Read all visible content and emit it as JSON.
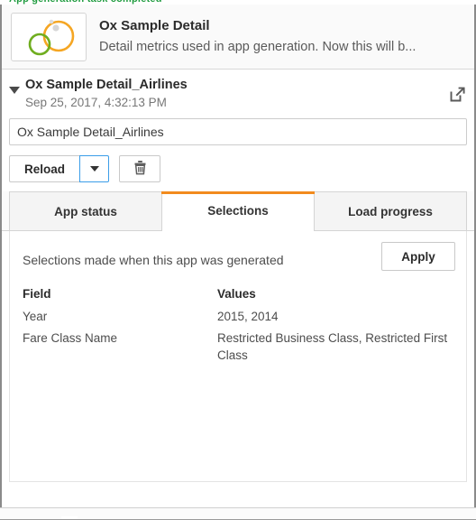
{
  "window": {
    "clipped_top_text": "App generation task completed"
  },
  "app_header": {
    "icon": "qlik-app-thumbnail-icon",
    "title": "Ox Sample Detail",
    "description": "Detail metrics used in app generation. Now this will b...",
    "logo_colors": {
      "orange": "#F5A623",
      "green": "#6FAD1F",
      "dot": "#D8D8D8"
    }
  },
  "task_header": {
    "caret_icon": "chevron-down-icon",
    "name": "Ox Sample Detail_Airlines",
    "timestamp": "Sep 25, 2017, 4:32:13 PM",
    "open_external_icon": "open-in-new-window-icon"
  },
  "name_field": {
    "value": "Ox Sample Detail_Airlines",
    "placeholder": "Ox Sample Detail_Airlines"
  },
  "actions": {
    "reload_label": "Reload",
    "reload_dropdown_icon": "caret-down-icon",
    "reload_dropdown_focus_color": "#3B9DE8",
    "delete_icon": "trash-icon"
  },
  "tabs": {
    "active_index": 1,
    "active_underline_color": "#F28B1E",
    "items": [
      {
        "label": "App status"
      },
      {
        "label": "Selections"
      },
      {
        "label": "Load progress"
      }
    ]
  },
  "selections_panel": {
    "caption": "Selections made when this app was generated",
    "apply_label": "Apply",
    "columns": [
      "Field",
      "Values"
    ],
    "rows": [
      {
        "field": "Year",
        "values": "2015, 2014"
      },
      {
        "field": "Fare Class Name",
        "values": "Restricted Business Class, Restricted First Class"
      }
    ]
  }
}
